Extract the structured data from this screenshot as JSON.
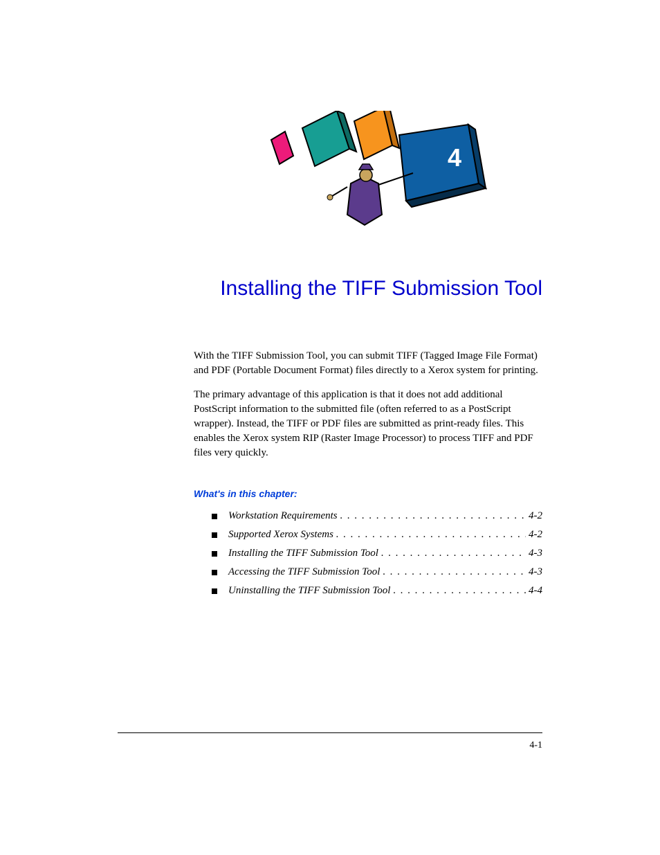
{
  "chapterNumber": "4",
  "chapterTitle": "Installing the TIFF Submission Tool",
  "paragraphs": [
    "With the TIFF Submission Tool, you can submit TIFF (Tagged Image File Format) and PDF (Portable Document Format) files directly to a Xerox system for printing.",
    "The primary advantage of this application is that it does not add additional PostScript information to the submitted file (often referred to as a PostScript wrapper). Instead, the TIFF or PDF files are submitted as print-ready files. This enables the Xerox system RIP (Raster Image Processor) to process TIFF and PDF files very quickly."
  ],
  "sectionHeading": "What's in this chapter:",
  "toc": [
    {
      "label": "Workstation Requirements",
      "page": "4-2"
    },
    {
      "label": "Supported Xerox Systems",
      "page": "4-2"
    },
    {
      "label": "Installing the TIFF Submission Tool",
      "page": "4-3"
    },
    {
      "label": "Accessing the TIFF Submission Tool",
      "page": "4-3"
    },
    {
      "label": "Uninstalling the TIFF Submission Tool",
      "page": "4-4"
    }
  ],
  "pageNumber": "4-1",
  "dots": ". . . . . . . . . . . . . . . . . . . . . . . . . . . . . . . . . . . . . . . . . . . . . . . . . . . . . . . . . . . . . . . . . . . . . ."
}
